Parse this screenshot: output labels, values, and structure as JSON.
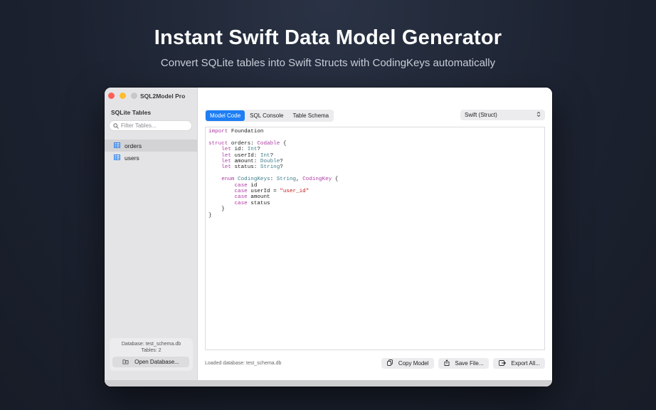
{
  "hero": {
    "title": "Instant Swift Data Model Generator",
    "subtitle": "Convert SQLite tables into Swift Structs with CodingKeys automatically"
  },
  "window": {
    "app_name": "SQL2Model Pro"
  },
  "sidebar": {
    "heading": "SQLite Tables",
    "search_placeholder": "Filter Tables...",
    "tables": [
      {
        "label": "orders",
        "selected": true
      },
      {
        "label": "users",
        "selected": false
      }
    ],
    "footer": {
      "database": "Database: test_schema.db",
      "tables_count": "Tables: 2",
      "open_button": "Open Database..."
    }
  },
  "main": {
    "tabs": [
      {
        "label": "Model Code",
        "active": true
      },
      {
        "label": "SQL Console",
        "active": false
      },
      {
        "label": "Table Schema",
        "active": false
      }
    ],
    "language_select": "Swift (Struct)",
    "code": [
      [
        {
          "t": "import",
          "c": "kw"
        },
        {
          "t": " Foundation"
        }
      ],
      [],
      [
        {
          "t": "struct",
          "c": "kw"
        },
        {
          "t": " orders: "
        },
        {
          "t": "Codable",
          "c": "kw"
        },
        {
          "t": " {"
        }
      ],
      [
        {
          "t": "    "
        },
        {
          "t": "let",
          "c": "kw"
        },
        {
          "t": " id: "
        },
        {
          "t": "Int",
          "c": "ty"
        },
        {
          "t": "?"
        }
      ],
      [
        {
          "t": "    "
        },
        {
          "t": "let",
          "c": "kw"
        },
        {
          "t": " userId: "
        },
        {
          "t": "Int",
          "c": "ty"
        },
        {
          "t": "?"
        }
      ],
      [
        {
          "t": "    "
        },
        {
          "t": "let",
          "c": "kw"
        },
        {
          "t": " amount: "
        },
        {
          "t": "Double",
          "c": "ty"
        },
        {
          "t": "?"
        }
      ],
      [
        {
          "t": "    "
        },
        {
          "t": "let",
          "c": "kw"
        },
        {
          "t": " status: "
        },
        {
          "t": "String",
          "c": "ty"
        },
        {
          "t": "?"
        }
      ],
      [],
      [
        {
          "t": "    "
        },
        {
          "t": "enum",
          "c": "kw"
        },
        {
          "t": " "
        },
        {
          "t": "CodingKeys",
          "c": "ty"
        },
        {
          "t": ": "
        },
        {
          "t": "String",
          "c": "ty"
        },
        {
          "t": ", "
        },
        {
          "t": "CodingKey",
          "c": "kw"
        },
        {
          "t": " {"
        }
      ],
      [
        {
          "t": "        "
        },
        {
          "t": "case",
          "c": "kw"
        },
        {
          "t": " id"
        }
      ],
      [
        {
          "t": "        "
        },
        {
          "t": "case",
          "c": "kw"
        },
        {
          "t": " userId = "
        },
        {
          "t": "\"user_id\"",
          "c": "str"
        }
      ],
      [
        {
          "t": "        "
        },
        {
          "t": "case",
          "c": "kw"
        },
        {
          "t": " amount"
        }
      ],
      [
        {
          "t": "        "
        },
        {
          "t": "case",
          "c": "kw"
        },
        {
          "t": " status"
        }
      ],
      [
        {
          "t": "    }"
        }
      ],
      [
        {
          "t": "}"
        }
      ]
    ],
    "status_text": "Loaded database: test_schema.db",
    "actions": [
      {
        "label": "Copy Model",
        "icon": "copy-icon"
      },
      {
        "label": "Save File...",
        "icon": "share-icon"
      },
      {
        "label": "Export All...",
        "icon": "export-icon"
      }
    ]
  }
}
